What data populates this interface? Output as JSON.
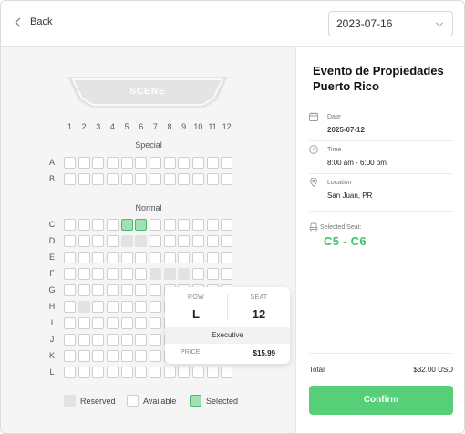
{
  "header": {
    "back_label": "Back",
    "date_value": "2023-07-16"
  },
  "stage": {
    "label": "SCENE"
  },
  "columns": [
    "1",
    "2",
    "3",
    "4",
    "5",
    "6",
    "7",
    "8",
    "9",
    "10",
    "11",
    "12"
  ],
  "sections": [
    {
      "label": "Special",
      "rows": [
        "A",
        "B"
      ]
    },
    {
      "label": "Normal",
      "rows": [
        "C",
        "D",
        "E",
        "F",
        "G",
        "H",
        "I",
        "J",
        "K",
        "L"
      ]
    }
  ],
  "seat_states": {
    "reserved": [
      "D5",
      "D6",
      "F7",
      "F8",
      "F9",
      "H2"
    ],
    "selected": [
      "C5",
      "C6"
    ]
  },
  "tooltip": {
    "row_header": "ROW",
    "row_value": "L",
    "seat_header": "SEAT",
    "seat_value": "12",
    "category": "Executive",
    "price_label": "PRICE",
    "price_value": "$15.99"
  },
  "legend": {
    "reserved": "Reserved",
    "available": "Available",
    "selected": "Selected"
  },
  "event": {
    "title": "Evento de Propiedades Puerto Rico",
    "date_label": "Date",
    "date_value": "2025-07-12",
    "time_label": "Time",
    "time_value": "8:00 am - 6:00 pm",
    "location_label": "Location",
    "location_value": "San Juan, PR",
    "selected_label": "Selected Seat:",
    "selected_value": "C5 - C6"
  },
  "summary": {
    "total_label": "Total",
    "total_value": "$32.00 USD",
    "confirm_label": "Confirm"
  },
  "colors": {
    "accent": "#56cf78",
    "selected_seat": "#9fe0b4",
    "reserved_seat": "#e2e2e2"
  }
}
